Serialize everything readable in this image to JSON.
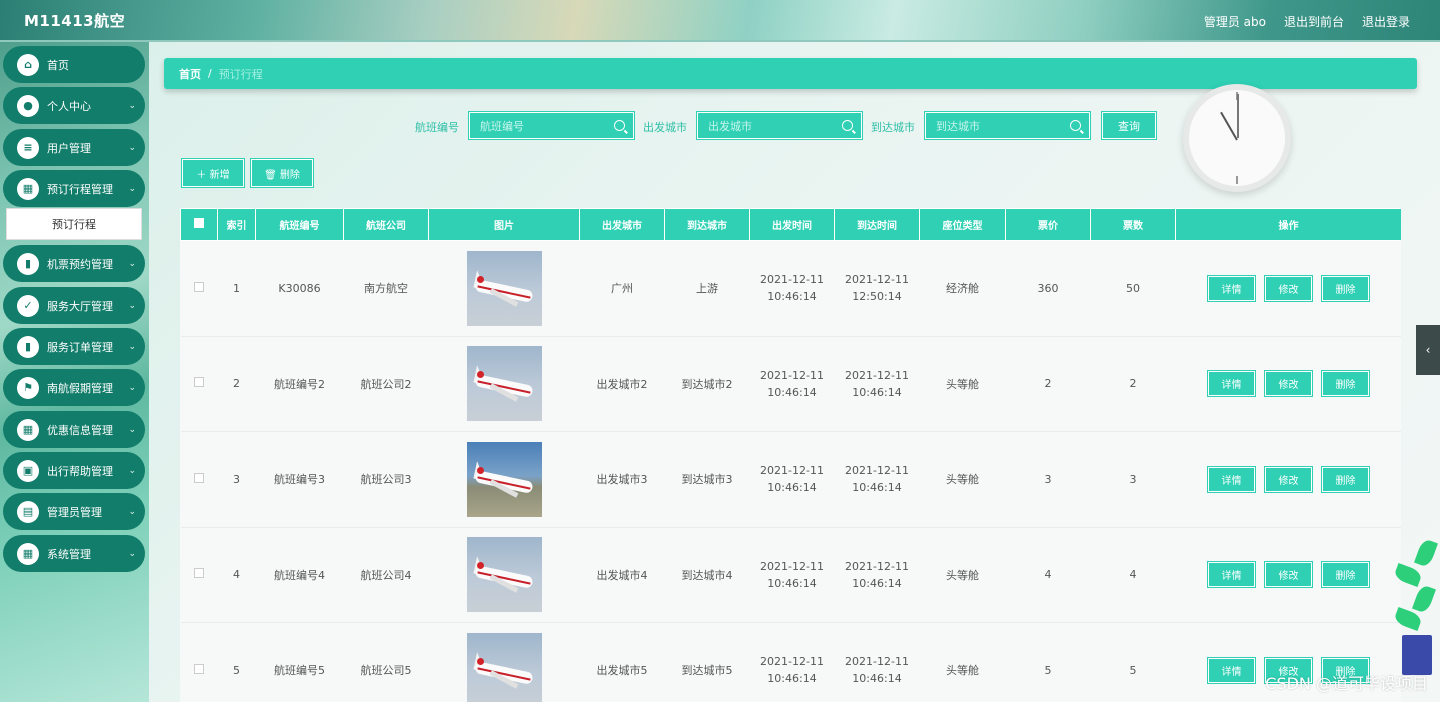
{
  "header": {
    "brand": "M11413航空",
    "admin": "管理员 abo",
    "back_to_front": "退出到前台",
    "logout": "退出登录"
  },
  "sidebar": {
    "items": [
      {
        "label": "首页",
        "icon": "home-icon",
        "glyph": "⌂",
        "chevron": false
      },
      {
        "label": "个人中心",
        "icon": "user-icon",
        "glyph": "●",
        "chevron": true
      },
      {
        "label": "用户管理",
        "icon": "sliders-icon",
        "glyph": "≡",
        "chevron": true
      },
      {
        "label": "预订行程管理",
        "icon": "grid-icon",
        "glyph": "▦",
        "chevron": true
      },
      {
        "label": "机票预约管理",
        "icon": "book-icon",
        "glyph": "▮",
        "chevron": true
      },
      {
        "label": "服务大厅管理",
        "icon": "clipboard-check-icon",
        "glyph": "✓",
        "chevron": true
      },
      {
        "label": "服务订单管理",
        "icon": "bar-chart-icon",
        "glyph": "▮",
        "chevron": true
      },
      {
        "label": "南航假期管理",
        "icon": "flag-icon",
        "glyph": "⚑",
        "chevron": true
      },
      {
        "label": "优惠信息管理",
        "icon": "grid-icon",
        "glyph": "▦",
        "chevron": true
      },
      {
        "label": "出行帮助管理",
        "icon": "briefcase-icon",
        "glyph": "▣",
        "chevron": true
      },
      {
        "label": "管理员管理",
        "icon": "document-icon",
        "glyph": "▤",
        "chevron": true
      },
      {
        "label": "系统管理",
        "icon": "grid-icon",
        "glyph": "▦",
        "chevron": true
      }
    ],
    "sub_item": "预订行程"
  },
  "breadcrumb": {
    "home": "首页",
    "separator": "/",
    "current": "预订行程"
  },
  "search": {
    "flight_no_label": "航班编号",
    "flight_no_placeholder": "航班编号",
    "from_label": "出发城市",
    "from_placeholder": "出发城市",
    "to_label": "到达城市",
    "to_placeholder": "到达城市",
    "query_button": "查询"
  },
  "actions": {
    "add": "＋ 新增",
    "delete": "🗑 删除"
  },
  "table": {
    "headers": [
      "索引",
      "航班编号",
      "航班公司",
      "图片",
      "出发城市",
      "到达城市",
      "出发时间",
      "到达时间",
      "座位类型",
      "票价",
      "票数",
      "操作"
    ],
    "rows": [
      {
        "index": "1",
        "flight_no": "K30086",
        "company": "南方航空",
        "from": "广州",
        "to": "上游",
        "depart": "2021-12-11 10:46:14",
        "arrive": "2021-12-11 12:50:14",
        "seat": "经济舱",
        "price": "360",
        "tickets": "50"
      },
      {
        "index": "2",
        "flight_no": "航班编号2",
        "company": "航班公司2",
        "from": "出发城市2",
        "to": "到达城市2",
        "depart": "2021-12-11 10:46:14",
        "arrive": "2021-12-11 10:46:14",
        "seat": "头等舱",
        "price": "2",
        "tickets": "2"
      },
      {
        "index": "3",
        "flight_no": "航班编号3",
        "company": "航班公司3",
        "from": "出发城市3",
        "to": "到达城市3",
        "depart": "2021-12-11 10:46:14",
        "arrive": "2021-12-11 10:46:14",
        "seat": "头等舱",
        "price": "3",
        "tickets": "3"
      },
      {
        "index": "4",
        "flight_no": "航班编号4",
        "company": "航班公司4",
        "from": "出发城市4",
        "to": "到达城市4",
        "depart": "2021-12-11 10:46:14",
        "arrive": "2021-12-11 10:46:14",
        "seat": "头等舱",
        "price": "4",
        "tickets": "4"
      },
      {
        "index": "5",
        "flight_no": "航班编号5",
        "company": "航班公司5",
        "from": "出发城市5",
        "to": "到达城市5",
        "depart": "2021-12-11 10:46:14",
        "arrive": "2021-12-11 10:46:14",
        "seat": "头等舱",
        "price": "5",
        "tickets": "5"
      }
    ],
    "op_detail": "详情",
    "op_edit": "修改",
    "op_delete": "删除"
  },
  "watermark": "CSDN @道可毕设项目",
  "colors": {
    "accent": "#2fd0b4",
    "sidebar_item": "#117d6a",
    "collapse_tab": "#3c4b4a"
  }
}
